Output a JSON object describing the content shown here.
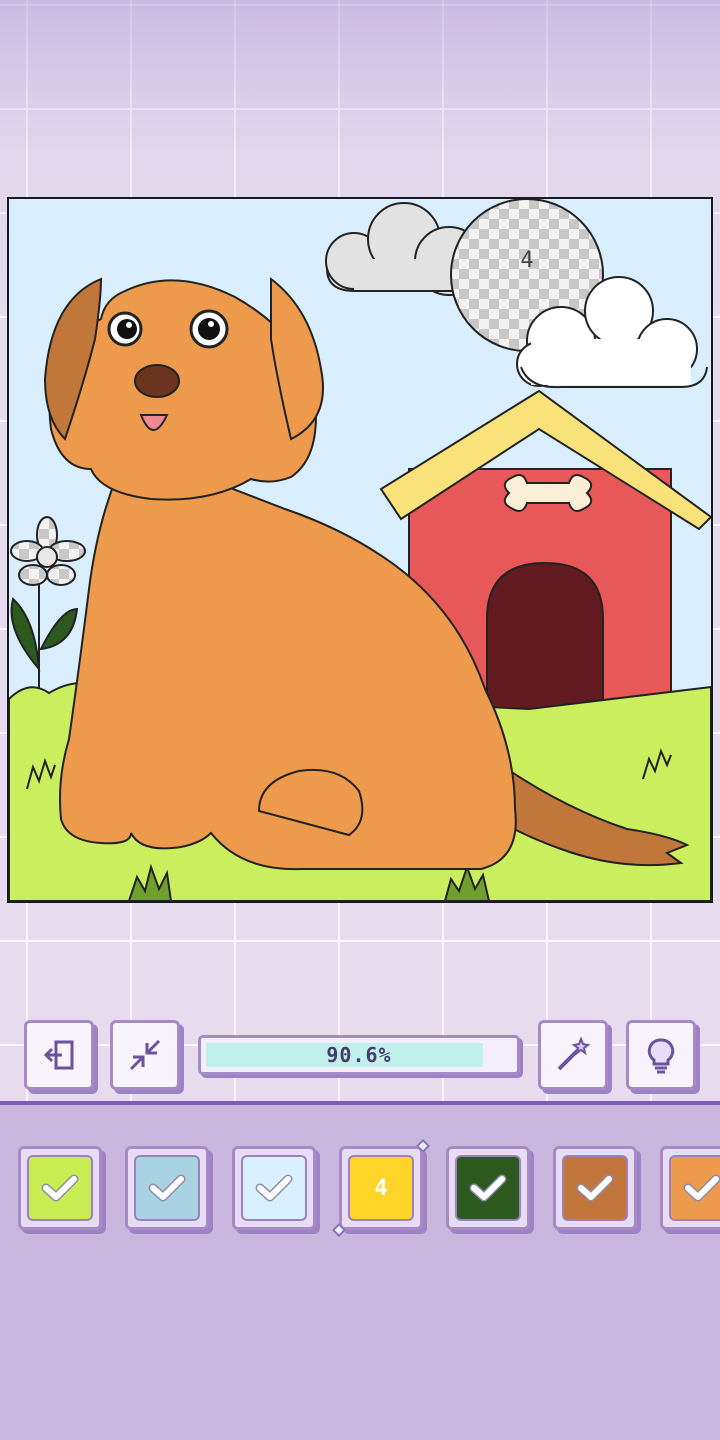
{
  "colors": {
    "background": "#c9b6dc",
    "accent": "#7e5cb3",
    "progress_fill": "#bff0ec"
  },
  "canvas": {
    "dog_fur": "#ee9a4c",
    "dog_ear": "#c2773a",
    "doghouse_wall": "#e85858",
    "doghouse_roof": "#f9e27a",
    "grass": "#caee5e",
    "sky": "#d9efff",
    "moon_number": "4"
  },
  "toolbar": {
    "exit_icon": "exit-icon",
    "collapse_icon": "collapse-arrows-icon",
    "progress": {
      "value": 0.906,
      "label": "90.6%"
    },
    "magic_wand_icon": "magic-wand-icon",
    "hint_icon": "lightbulb-icon"
  },
  "palette": [
    {
      "color": "#c8ec52",
      "state": "done",
      "label": ""
    },
    {
      "color": "#a9d3e2",
      "state": "done",
      "label": ""
    },
    {
      "color": "#d8f0ff",
      "state": "done",
      "label": ""
    },
    {
      "color": "#ffd52a",
      "state": "selected",
      "label": "4"
    },
    {
      "color": "#2d5a1e",
      "state": "done",
      "label": ""
    },
    {
      "color": "#c1753a",
      "state": "done",
      "label": ""
    },
    {
      "color": "#ee9a4c",
      "state": "done",
      "label": ""
    }
  ]
}
